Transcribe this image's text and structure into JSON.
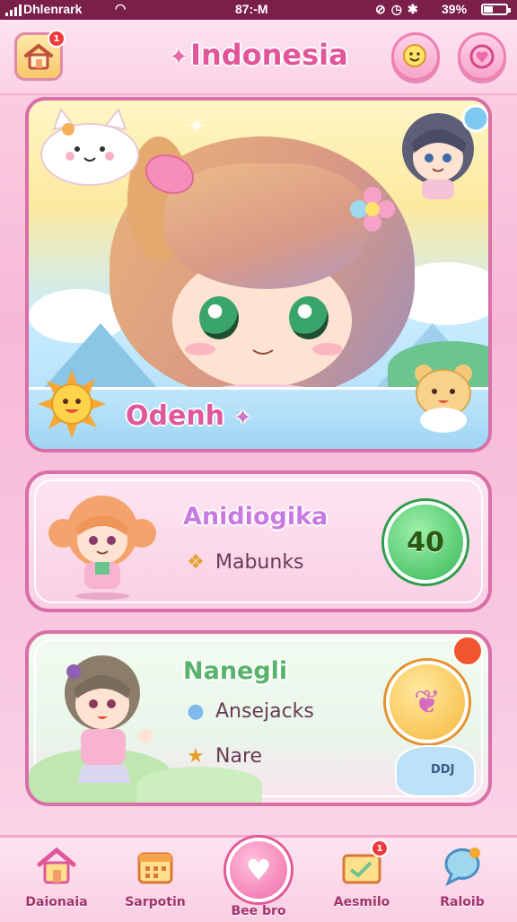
{
  "status_bar": {
    "carrier": "Dhlenrark",
    "time": "87:-M",
    "battery": "39%"
  },
  "header": {
    "title": "Indonesia",
    "home_badge": "1"
  },
  "hero": {
    "name": "Odenh"
  },
  "cards": [
    {
      "name": "Anidiogika",
      "detail": "Mabunks",
      "score": "40"
    },
    {
      "name": "Nanegli",
      "detail_1": "Ansejacks",
      "detail_2": "Nare",
      "badge_text": "DDJ"
    }
  ],
  "bottom_nav": {
    "items": [
      {
        "label": "Daionaia",
        "icon": "home-icon"
      },
      {
        "label": "Sarpotin",
        "icon": "calendar-icon"
      },
      {
        "label": "Bee bro",
        "icon": "heart-icon"
      },
      {
        "label": "Aesmilo",
        "icon": "mail-icon",
        "badge": "1"
      },
      {
        "label": "Raloib",
        "icon": "chat-icon"
      }
    ]
  }
}
